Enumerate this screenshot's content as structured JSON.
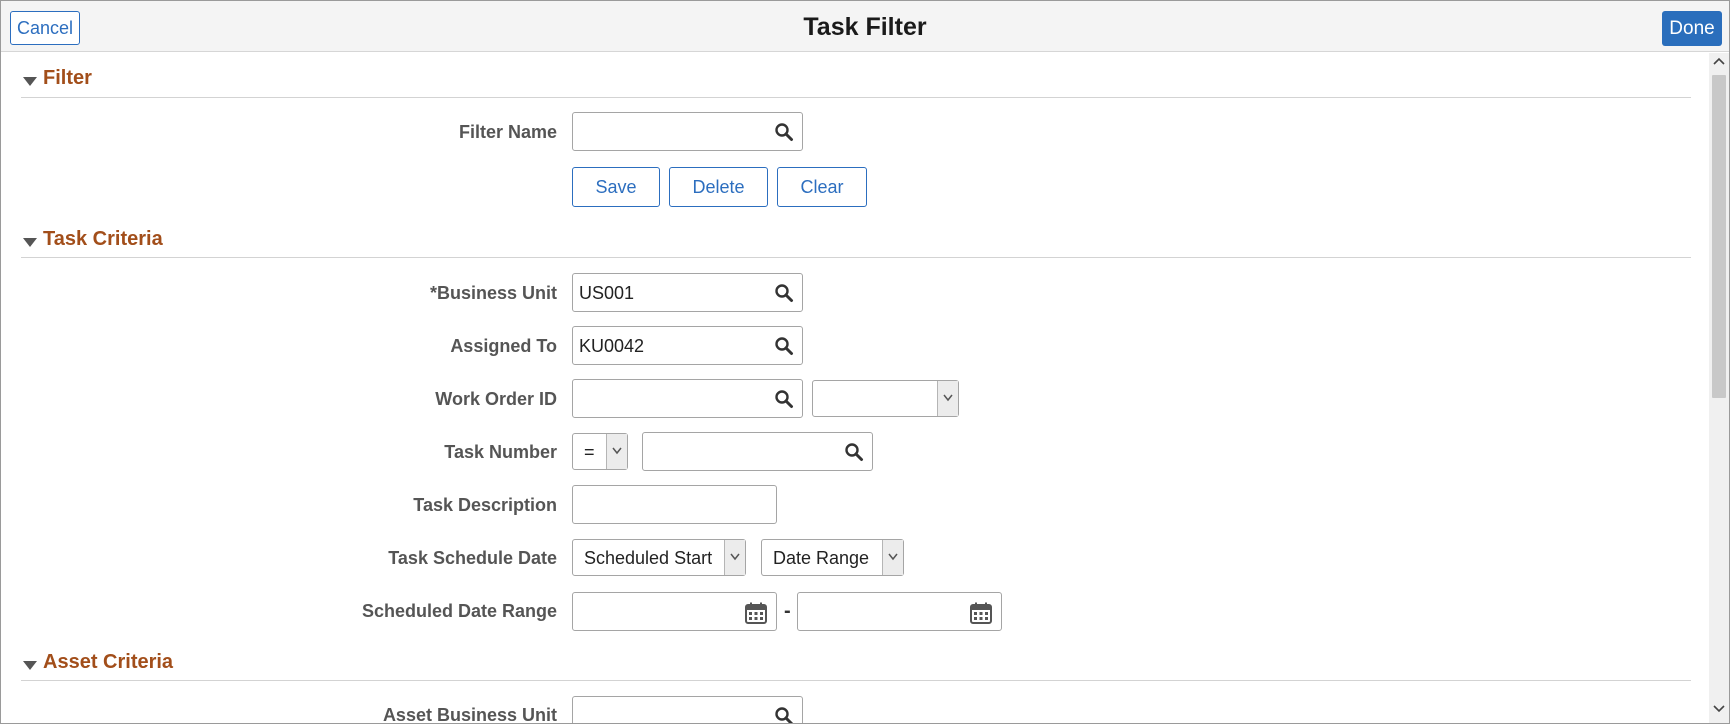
{
  "header": {
    "title": "Task Filter",
    "cancel_label": "Cancel",
    "done_label": "Done"
  },
  "sections": {
    "filter": {
      "title": "Filter",
      "filter_name_label": "Filter Name",
      "filter_name_value": "",
      "buttons": {
        "save": "Save",
        "delete": "Delete",
        "clear": "Clear"
      }
    },
    "task_criteria": {
      "title": "Task Criteria",
      "business_unit_label": "*Business Unit",
      "business_unit_value": "US001",
      "assigned_to_label": "Assigned To",
      "assigned_to_value": "KU0042",
      "work_order_label": "Work Order ID",
      "work_order_value": "",
      "work_order_select": "",
      "task_number_label": "Task Number",
      "task_number_operator": "=",
      "task_number_value": "",
      "task_description_label": "Task Description",
      "task_description_value": "",
      "task_schedule_date_label": "Task Schedule Date",
      "schedule_type": "Scheduled Start",
      "schedule_mode": "Date Range",
      "scheduled_date_range_label": "Scheduled Date Range",
      "date_from": "",
      "date_separator": "-",
      "date_to": ""
    },
    "asset_criteria": {
      "title": "Asset Criteria",
      "asset_business_unit_label": "Asset Business Unit",
      "asset_business_unit_value": ""
    }
  },
  "icons": {
    "lookup": "magnifier-icon",
    "calendar": "calendar-icon",
    "dropdown": "chevron-down-icon",
    "collapse": "triangle-down-icon"
  },
  "colors": {
    "accent": "#2c6ebf",
    "section_title": "#a24e1a",
    "label": "#555555"
  }
}
